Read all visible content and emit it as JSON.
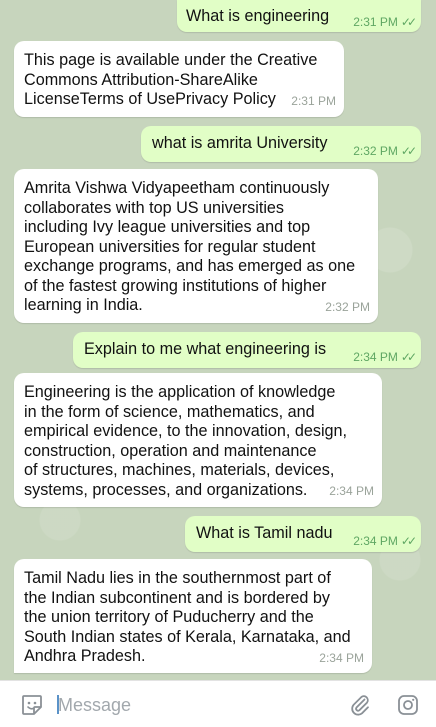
{
  "messages": [
    {
      "direction": "outgoing",
      "text": "What is engineering",
      "time": "2:31 PM",
      "status_icon": "double-check-icon"
    },
    {
      "direction": "incoming",
      "text": "This page is available under the Creative\nCommons Attribution-ShareAlike\nLicenseTerms of UsePrivacy Policy",
      "time": "2:31 PM"
    },
    {
      "direction": "outgoing",
      "text": "what is amrita University",
      "time": "2:32 PM",
      "status_icon": "double-check-icon"
    },
    {
      "direction": "incoming",
      "text": "Amrita Vishwa Vidyapeetham continuously\ncollaborates with top US universities\nincluding Ivy league universities and top\nEuropean universities for regular student\nexchange programs, and has emerged as one\nof the fastest growing institutions of higher\nlearning in India.",
      "time": "2:32 PM"
    },
    {
      "direction": "outgoing",
      "text": "Explain to me what engineering is",
      "time": "2:34 PM",
      "status_icon": "double-check-icon"
    },
    {
      "direction": "incoming",
      "text": "Engineering is the application of knowledge\nin the form of science, mathematics, and\nempirical evidence, to the innovation, design,\nconstruction, operation and maintenance\nof structures, machines, materials, devices,\nsystems, processes, and organizations.",
      "time": "2:34 PM"
    },
    {
      "direction": "outgoing",
      "text": "What is Tamil nadu",
      "time": "2:34 PM",
      "status_icon": "double-check-icon"
    },
    {
      "direction": "incoming",
      "text": "Tamil Nadu lies in the southernmost part of\nthe Indian subcontinent and is bordered by\nthe union territory of Puducherry and the\nSouth Indian states of Kerala, Karnataka, and\nAndhra Pradesh.",
      "time": "2:34 PM"
    }
  ],
  "composer": {
    "placeholder": "Message",
    "emoji_icon": "sticker-icon",
    "attach_icon": "paperclip-icon",
    "camera_icon": "instagram-camera-icon"
  },
  "colors": {
    "outgoing_bubble": "#e1fec6",
    "incoming_bubble": "#ffffff",
    "chat_background": "#c7d5bd",
    "check": "#5fa763"
  }
}
